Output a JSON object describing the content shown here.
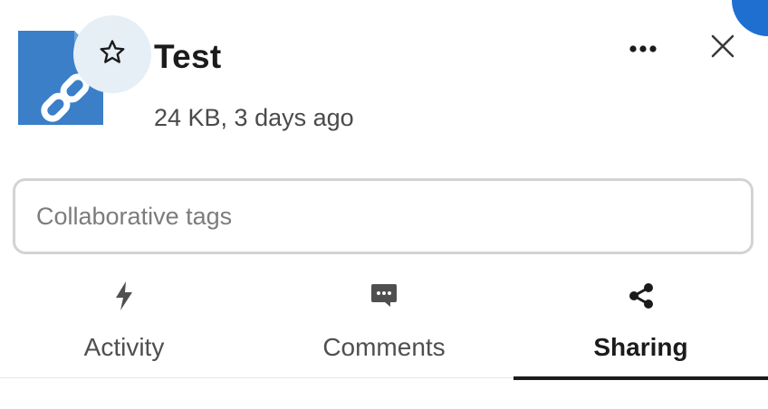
{
  "file": {
    "name": "Test",
    "subtitle": "24 KB, 3 days ago",
    "icon": "link-file-icon",
    "icon_color": "#3a7fc8"
  },
  "actions": {
    "favorite_icon": "star-outline-icon",
    "more_icon": "ellipsis-icon",
    "close_icon": "close-icon"
  },
  "tags": {
    "placeholder": "Collaborative tags",
    "value": ""
  },
  "tabs": [
    {
      "label": "Activity",
      "icon": "lightning-icon",
      "active": false
    },
    {
      "label": "Comments",
      "icon": "comment-icon",
      "active": false
    },
    {
      "label": "Sharing",
      "icon": "share-icon",
      "active": true
    }
  ],
  "colors": {
    "accent": "#1f6fd0",
    "favorite_bg": "#e6eff6",
    "active_tab": "#1b1b1b",
    "inactive_tab": "#4f4f4f"
  }
}
